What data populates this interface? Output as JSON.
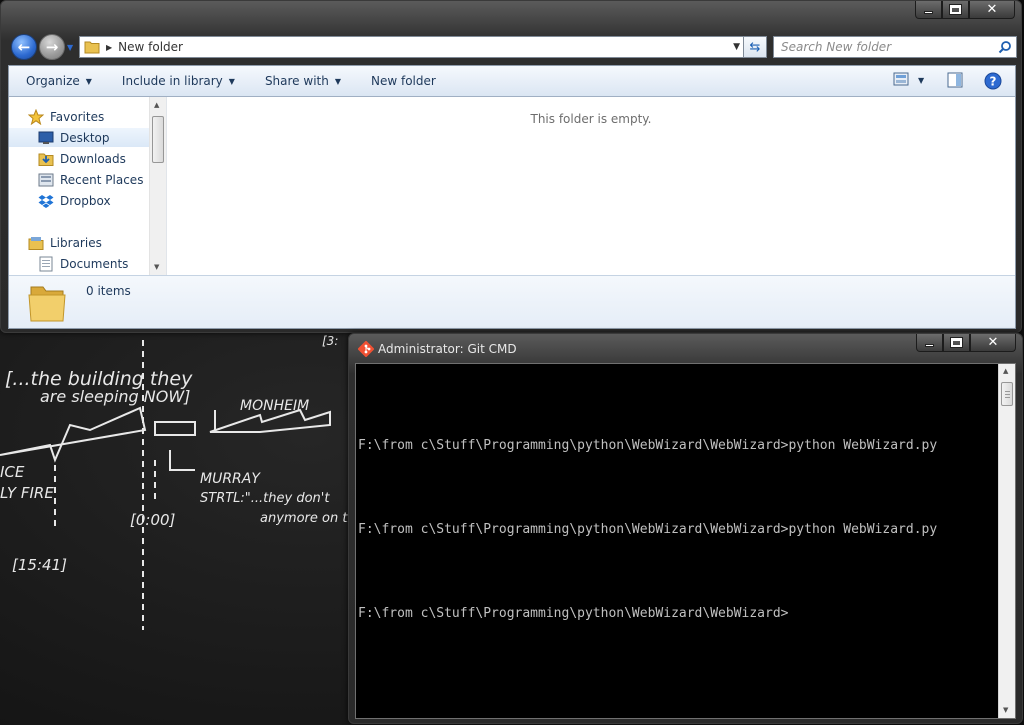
{
  "explorer": {
    "address": {
      "current_folder": "New folder"
    },
    "search": {
      "placeholder": "Search New folder"
    },
    "toolbar": {
      "organize": "Organize",
      "include_in_library": "Include in library",
      "share_with": "Share with",
      "new_folder": "New folder"
    },
    "nav_pane": {
      "items": [
        {
          "label": "Favorites",
          "icon": "star-icon"
        },
        {
          "label": "Desktop",
          "icon": "desktop-icon",
          "selected": true
        },
        {
          "label": "Downloads",
          "icon": "downloads-folder-icon"
        },
        {
          "label": "Recent Places",
          "icon": "recent-places-icon"
        },
        {
          "label": "Dropbox",
          "icon": "dropbox-icon"
        },
        {
          "label": "Libraries",
          "icon": "libraries-icon"
        },
        {
          "label": "Documents",
          "icon": "documents-icon"
        }
      ]
    },
    "content": {
      "empty_message": "This folder is empty."
    },
    "details": {
      "item_count": "0 items"
    }
  },
  "gitcmd": {
    "title": "Administrator: Git CMD",
    "lines": [
      "F:\\from c\\Stuff\\Programming\\python\\WebWizard\\WebWizard>python WebWizard.py",
      "F:\\from c\\Stuff\\Programming\\python\\WebWizard\\WebWizard>python WebWizard.py",
      "F:\\from c\\Stuff\\Programming\\python\\WebWizard\\WebWizard>"
    ]
  },
  "wallpaper": {
    "handwriting": [
      "[...the building they",
      "are sleeping NOW]",
      "MONHEIM",
      "MURRAY",
      "STRTL:\"...they don't",
      "anymore on th",
      "ICE",
      "LY FIRE",
      "[0:00]",
      "[15:41]",
      "[3:"
    ]
  },
  "colors": {
    "accent": "#1e395b",
    "nav_selected": "#dbe8f7",
    "console_bg": "#000000",
    "console_text": "#c0c0c0"
  }
}
